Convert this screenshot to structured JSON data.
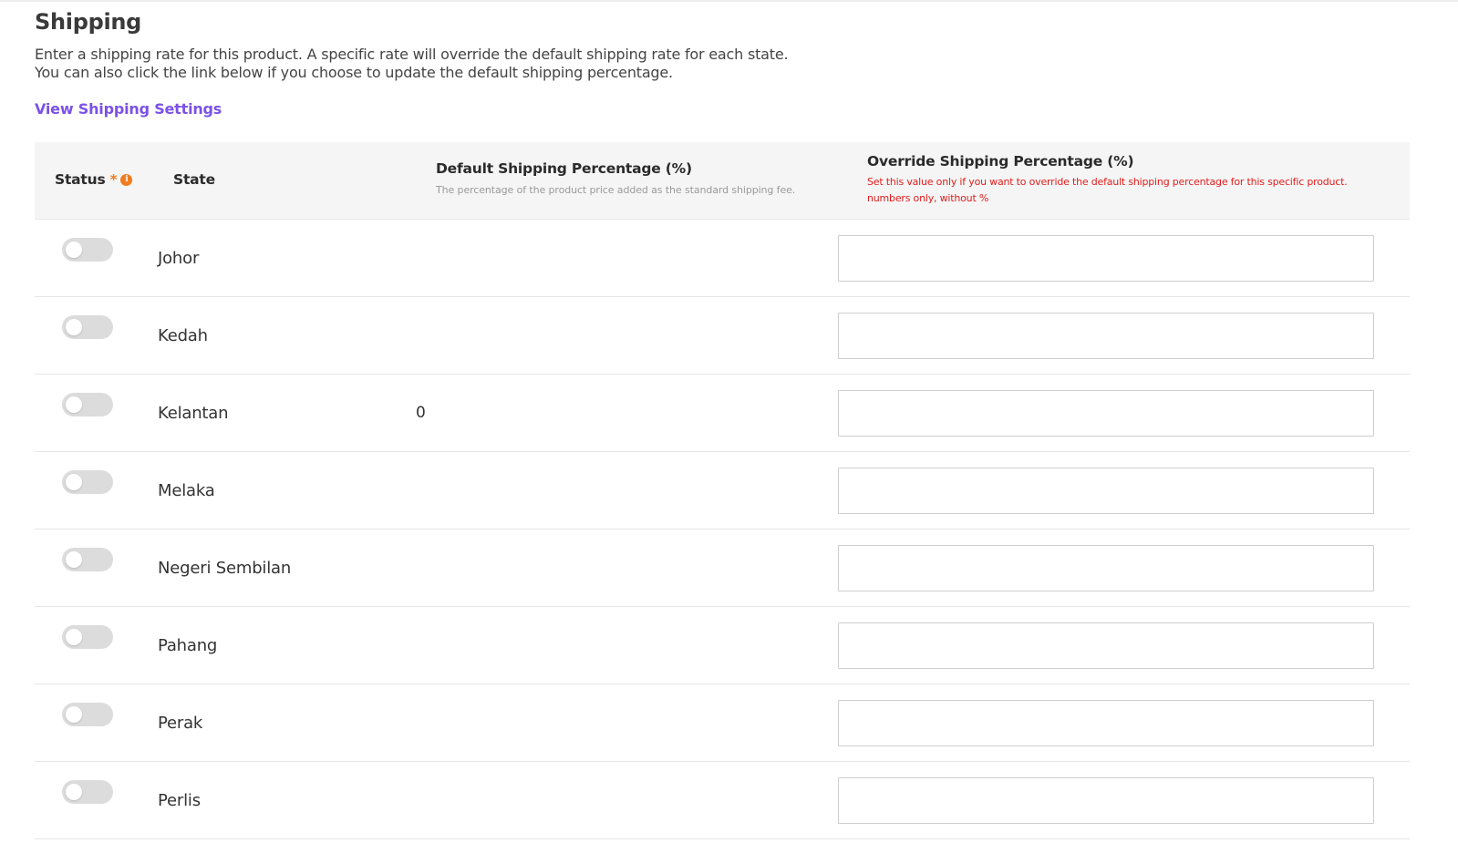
{
  "header": {
    "title": "Shipping",
    "description_line1": "Enter a shipping rate for this product. A specific rate will override the default shipping rate for each state.",
    "description_line2": "You can also click the link below if you choose to update the default shipping percentage.",
    "settings_link": "View Shipping Settings"
  },
  "table": {
    "columns": {
      "status": "Status",
      "status_required": "*",
      "state": "State",
      "default": "Default Shipping Percentage (%)",
      "default_note": "The percentage of the product price added as the standard shipping fee.",
      "override": "Override Shipping Percentage (%)",
      "override_note": "Set this value only if you want to override the default shipping percentage for this specific product. numbers only, without %"
    },
    "rows": [
      {
        "state": "Johor",
        "default": "",
        "override": "",
        "enabled": false
      },
      {
        "state": "Kedah",
        "default": "",
        "override": "",
        "enabled": false
      },
      {
        "state": "Kelantan",
        "default": "0",
        "override": "",
        "enabled": false
      },
      {
        "state": "Melaka",
        "default": "",
        "override": "",
        "enabled": false
      },
      {
        "state": "Negeri Sembilan",
        "default": "",
        "override": "",
        "enabled": false
      },
      {
        "state": "Pahang",
        "default": "",
        "override": "",
        "enabled": false
      },
      {
        "state": "Perak",
        "default": "",
        "override": "",
        "enabled": false
      },
      {
        "state": "Perlis",
        "default": "",
        "override": "",
        "enabled": false
      }
    ]
  },
  "colors": {
    "link": "#7b52e6",
    "required": "#f07c1e",
    "warning_note": "#e11d1d",
    "toggle_off": "#dcdcdc",
    "header_bg": "#f5f5f5"
  },
  "icons": {
    "status_info": "info-icon"
  }
}
